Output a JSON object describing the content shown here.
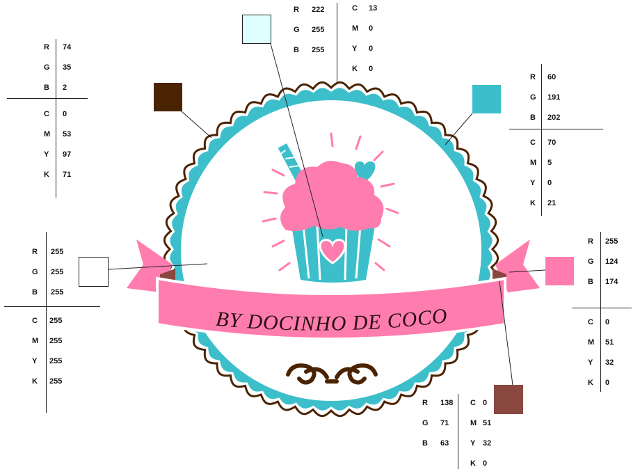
{
  "logo": {
    "banner_text": "BY DOCINHO DE COCO"
  },
  "palette": [
    {
      "id": "light-cyan",
      "hex": "#DEFFFF",
      "rgb": [
        {
          "k": "R",
          "v": "222"
        },
        {
          "k": "G",
          "v": "255"
        },
        {
          "k": "B",
          "v": "255"
        }
      ],
      "cmyk": [
        {
          "k": "C",
          "v": "13"
        },
        {
          "k": "M",
          "v": "0"
        },
        {
          "k": "Y",
          "v": "0"
        },
        {
          "k": "K",
          "v": "0"
        }
      ]
    },
    {
      "id": "dark-brown",
      "hex": "#4A2302",
      "rgb": [
        {
          "k": "R",
          "v": "74"
        },
        {
          "k": "G",
          "v": "35"
        },
        {
          "k": "B",
          "v": "2"
        }
      ],
      "cmyk": [
        {
          "k": "C",
          "v": "0"
        },
        {
          "k": "M",
          "v": "53"
        },
        {
          "k": "Y",
          "v": "97"
        },
        {
          "k": "K",
          "v": "71"
        }
      ]
    },
    {
      "id": "teal",
      "hex": "#3CBFCA",
      "rgb": [
        {
          "k": "R",
          "v": "60"
        },
        {
          "k": "G",
          "v": "191"
        },
        {
          "k": "B",
          "v": "202"
        }
      ],
      "cmyk": [
        {
          "k": "C",
          "v": "70"
        },
        {
          "k": "M",
          "v": "5"
        },
        {
          "k": "Y",
          "v": "0"
        },
        {
          "k": "K",
          "v": "21"
        }
      ]
    },
    {
      "id": "white",
      "hex": "#FFFFFF",
      "rgb": [
        {
          "k": "R",
          "v": "255"
        },
        {
          "k": "G",
          "v": "255"
        },
        {
          "k": "B",
          "v": "255"
        }
      ],
      "cmyk": [
        {
          "k": "C",
          "v": "255"
        },
        {
          "k": "M",
          "v": "255"
        },
        {
          "k": "Y",
          "v": "255"
        },
        {
          "k": "K",
          "v": "255"
        }
      ]
    },
    {
      "id": "pink",
      "hex": "#FF7CAE",
      "rgb": [
        {
          "k": "R",
          "v": "255"
        },
        {
          "k": "G",
          "v": "124"
        },
        {
          "k": "B",
          "v": "174"
        }
      ],
      "cmyk": [
        {
          "k": "C",
          "v": "0"
        },
        {
          "k": "M",
          "v": "51"
        },
        {
          "k": "Y",
          "v": "32"
        },
        {
          "k": "K",
          "v": "0"
        }
      ]
    },
    {
      "id": "reddish-brown",
      "hex": "#8A473F",
      "rgb": [
        {
          "k": "R",
          "v": "138"
        },
        {
          "k": "G",
          "v": "71"
        },
        {
          "k": "B",
          "v": "63"
        }
      ],
      "cmyk": [
        {
          "k": "C",
          "v": "0"
        },
        {
          "k": "M",
          "v": "51"
        },
        {
          "k": "Y",
          "v": "32"
        },
        {
          "k": "K",
          "v": "0"
        }
      ]
    }
  ]
}
